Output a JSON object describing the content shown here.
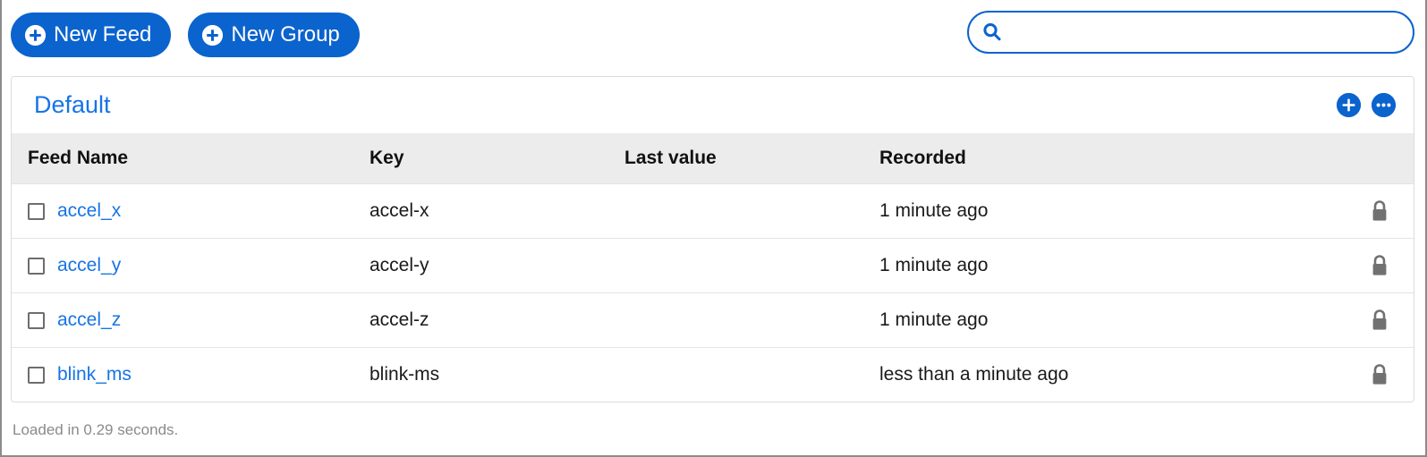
{
  "toolbar": {
    "new_feed_label": "New Feed",
    "new_group_label": "New Group",
    "plus_icon": "plus-circle-icon"
  },
  "search": {
    "value": "",
    "placeholder": "",
    "icon": "search-icon"
  },
  "group_card": {
    "title": "Default",
    "actions": [
      {
        "name": "add-feed-button",
        "icon": "plus-icon"
      },
      {
        "name": "more-options-button",
        "icon": "ellipsis-icon"
      }
    ]
  },
  "table": {
    "columns": [
      "Feed Name",
      "Key",
      "Last value",
      "Recorded"
    ],
    "rows": [
      {
        "name": "accel_x",
        "key": "accel-x",
        "last_value": "",
        "recorded": "1 minute ago",
        "locked": true,
        "lock_icon": "lock-icon",
        "checked": false
      },
      {
        "name": "accel_y",
        "key": "accel-y",
        "last_value": "",
        "recorded": "1 minute ago",
        "locked": true,
        "lock_icon": "lock-icon",
        "checked": false
      },
      {
        "name": "accel_z",
        "key": "accel-z",
        "last_value": "",
        "recorded": "1 minute ago",
        "locked": true,
        "lock_icon": "lock-icon",
        "checked": false
      },
      {
        "name": "blink_ms",
        "key": "blink-ms",
        "last_value": "",
        "recorded": "less than a minute ago",
        "locked": true,
        "lock_icon": "lock-icon",
        "checked": false
      }
    ]
  },
  "footer": {
    "load_time_text": "Loaded in 0.29 seconds."
  },
  "colors": {
    "accent_blue": "#0b63ce",
    "link_blue": "#1774e6",
    "header_band": "#ececec",
    "lock_gray": "#717171",
    "muted_text": "#8a8a8a"
  }
}
